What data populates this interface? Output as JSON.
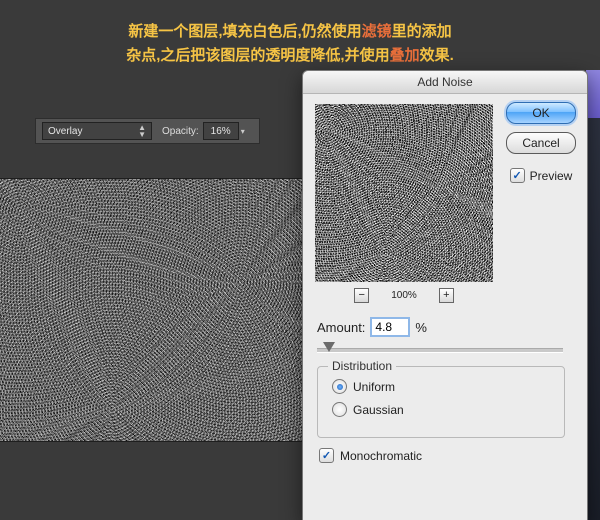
{
  "caption": {
    "line1_a": "新建一个图层,填充白色后,仍然使用",
    "line1_b": "滤镜",
    "line1_c": "里的添加",
    "line2_a": "杂点,之后把该图层的透明度降低,并使用",
    "line2_b": "叠加",
    "line2_c": "效果."
  },
  "optionsBar": {
    "blendMode": "Overlay",
    "opacityLabel": "Opacity:",
    "opacityValue": "16%"
  },
  "dialog": {
    "title": "Add Noise",
    "okLabel": "OK",
    "cancelLabel": "Cancel",
    "previewLabel": "Preview",
    "previewChecked": true,
    "zoomPercent": "100%",
    "amountLabel": "Amount:",
    "amountValue": "4.8",
    "amountUnit": "%",
    "distribution": {
      "legend": "Distribution",
      "uniform": "Uniform",
      "gaussian": "Gaussian",
      "selected": "uniform"
    },
    "monochromaticLabel": "Monochromatic",
    "monochromaticChecked": true
  }
}
